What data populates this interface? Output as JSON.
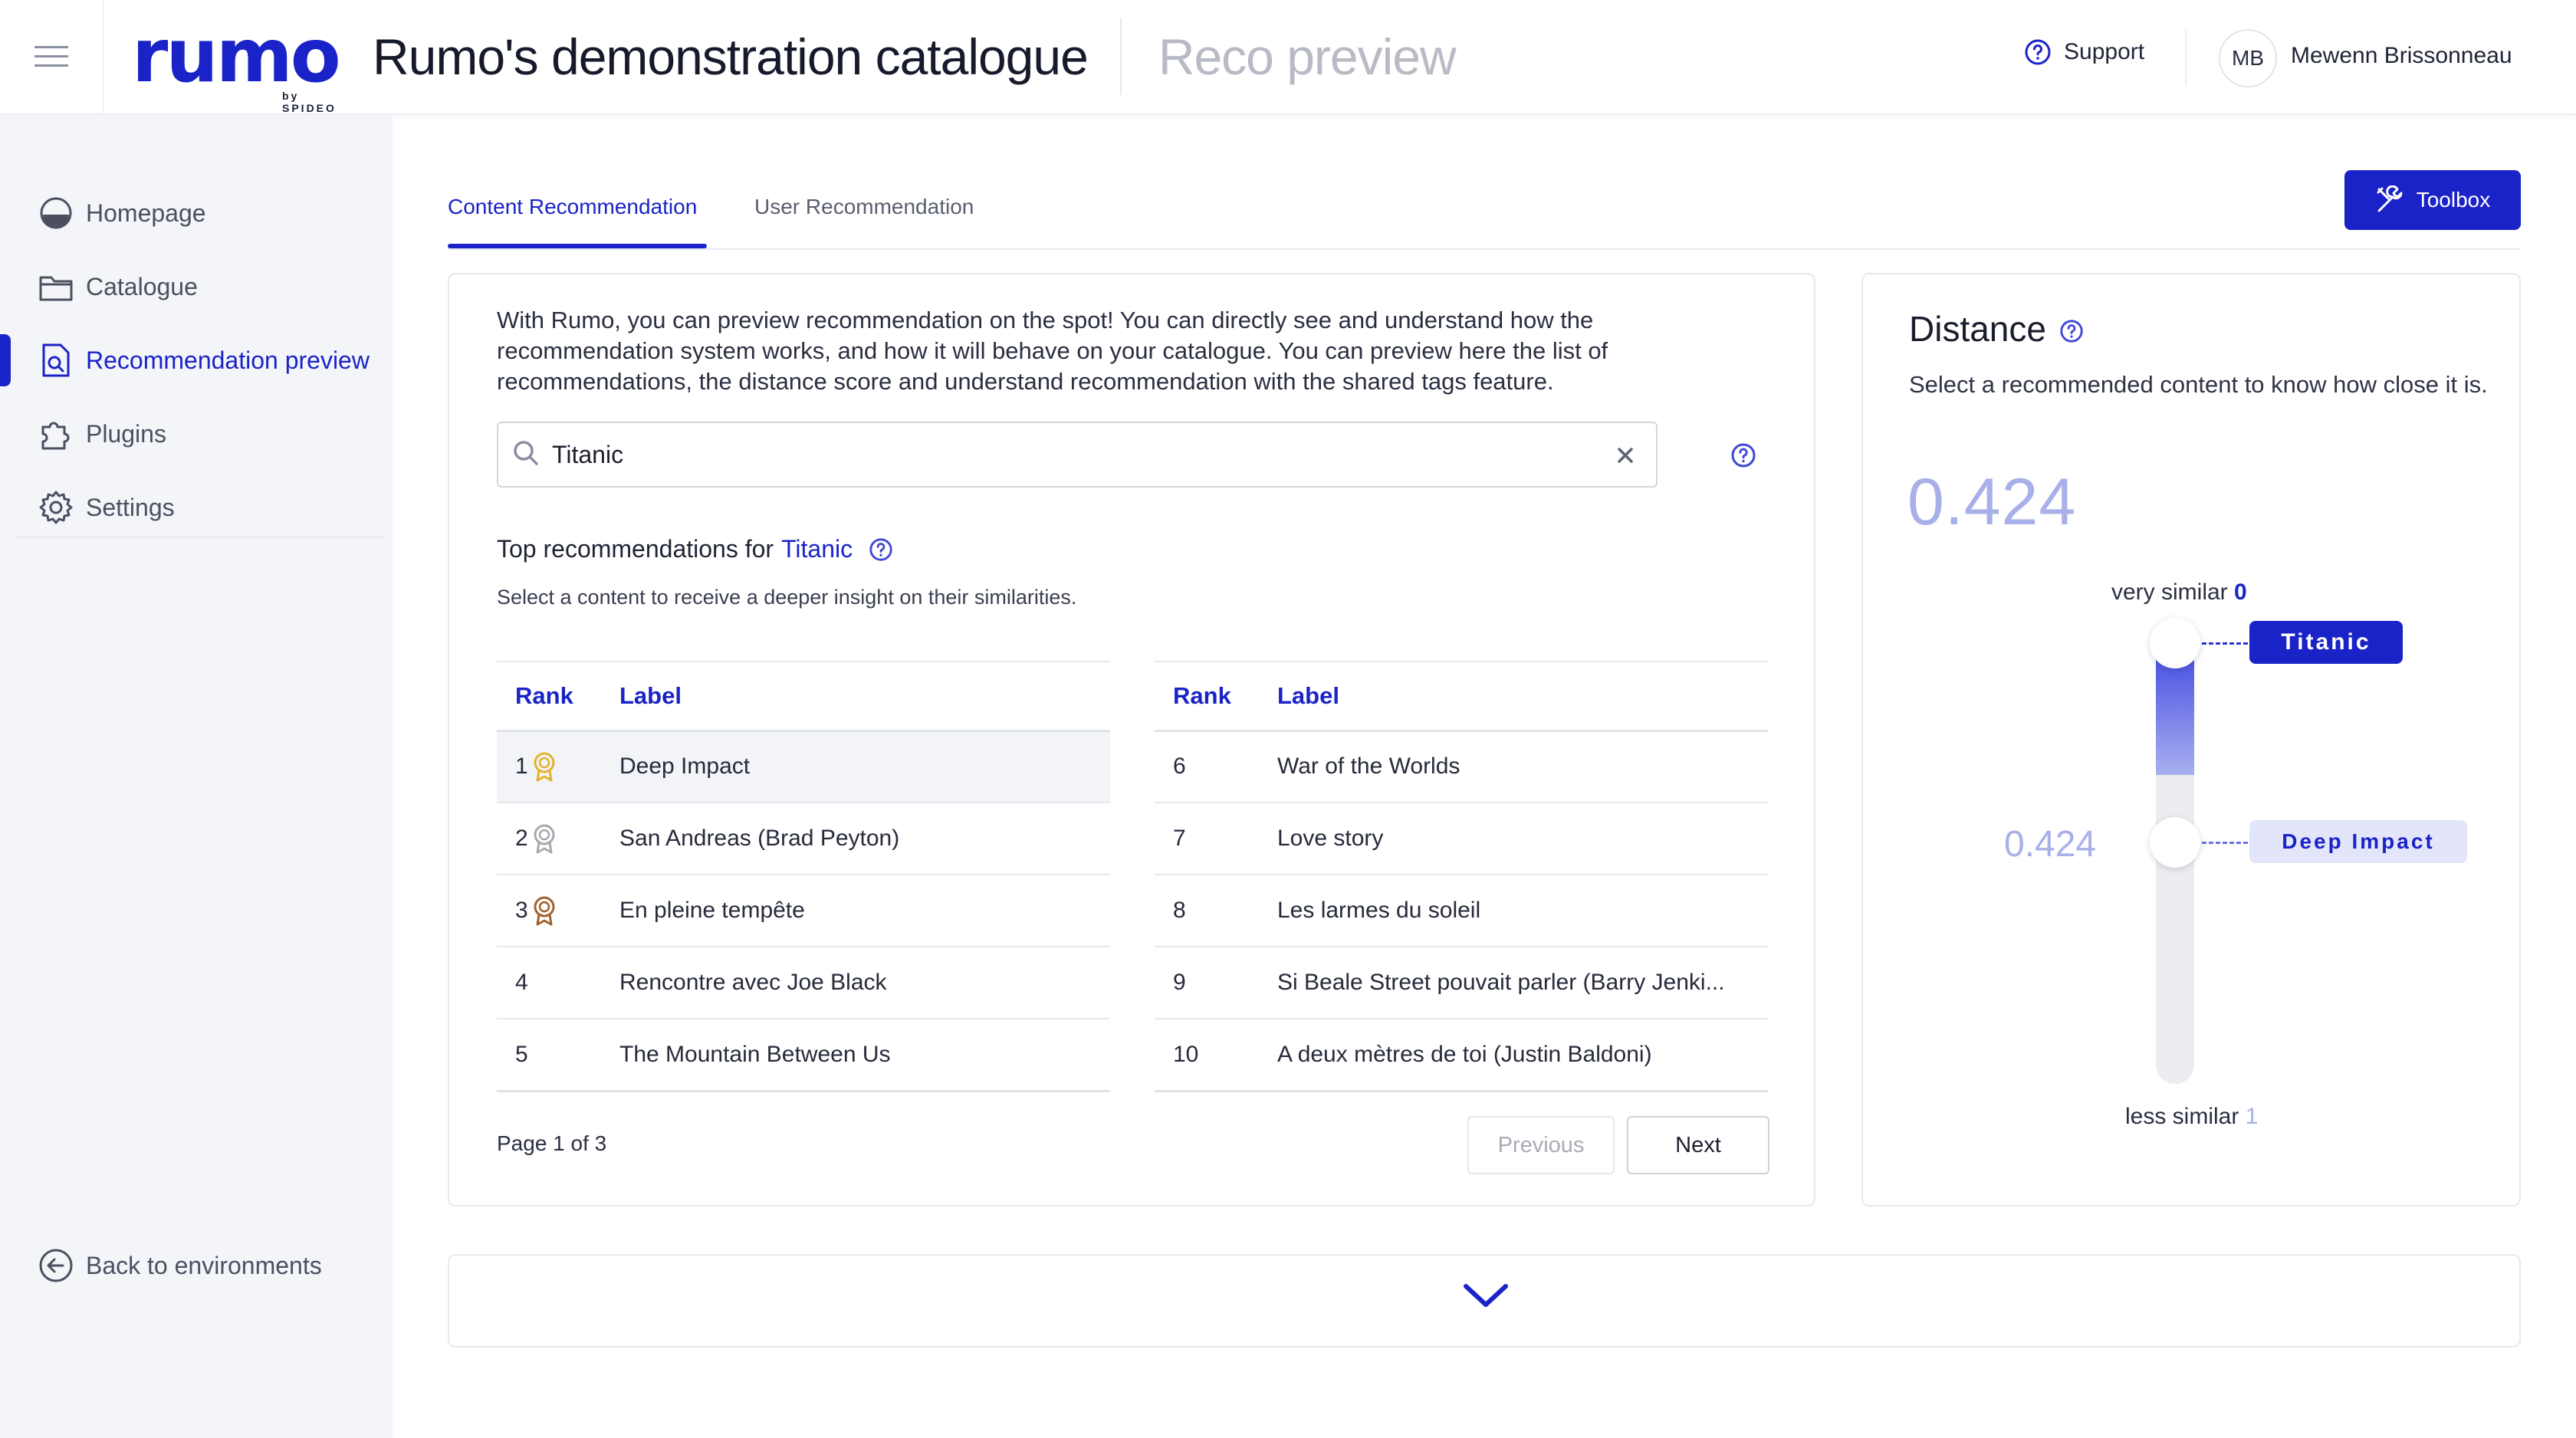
{
  "header": {
    "logo": "rumo",
    "logo_sub": "by SPIDEO",
    "title": "Rumo's demonstration catalogue",
    "subtitle": "Reco preview",
    "support": "Support",
    "user_initials": "MB",
    "user_name": "Mewenn Brissonneau"
  },
  "sidebar": {
    "items": [
      {
        "label": "Homepage",
        "icon": "homepage-icon"
      },
      {
        "label": "Catalogue",
        "icon": "folder-icon"
      },
      {
        "label": "Recommendation preview",
        "icon": "document-search-icon",
        "active": true
      },
      {
        "label": "Plugins",
        "icon": "puzzle-icon"
      },
      {
        "label": "Settings",
        "icon": "gear-icon"
      }
    ],
    "back": "Back to environments"
  },
  "tabs": {
    "content": "Content Recommendation",
    "user": "User Recommendation",
    "toolbox": "Toolbox"
  },
  "main": {
    "intro": "With Rumo, you can preview recommendation on the spot! You can directly see and understand how the recommendation system works, and how it will behave on your catalogue. You can preview here the list of recommendations, the distance score and understand recommendation with the shared tags feature.",
    "search_value": "Titanic",
    "reco_prefix": "Top recommendations for",
    "reco_film": "Titanic",
    "reco_sub": "Select a content to receive a deeper insight on their similarities.",
    "col_rank": "Rank",
    "col_label": "Label",
    "rows_left": [
      {
        "rank": "1",
        "label": "Deep Impact",
        "medal": "gold"
      },
      {
        "rank": "2",
        "label": "San Andreas (Brad Peyton)",
        "medal": "silver"
      },
      {
        "rank": "3",
        "label": "En pleine tempête",
        "medal": "bronze"
      },
      {
        "rank": "4",
        "label": "Rencontre avec Joe Black"
      },
      {
        "rank": "5",
        "label": "The Mountain Between Us"
      }
    ],
    "rows_right": [
      {
        "rank": "6",
        "label": "War of the Worlds"
      },
      {
        "rank": "7",
        "label": "Love story"
      },
      {
        "rank": "8",
        "label": "Les larmes du soleil"
      },
      {
        "rank": "9",
        "label": "Si Beale Street pouvait parler (Barry Jenki..."
      },
      {
        "rank": "10",
        "label": "A deux mètres de toi (Justin Baldoni)"
      }
    ],
    "page_info": "Page 1 of 3",
    "prev": "Previous",
    "next": "Next"
  },
  "distance": {
    "title": "Distance",
    "desc": "Select a recommended content to know how close it is.",
    "value": "0.424",
    "very_similar": "very similar",
    "very_similar_val": "0",
    "less_similar": "less similar",
    "less_similar_val": "1",
    "top_label": "Titanic",
    "bottom_label": "Deep Impact",
    "scale_value": "0.424",
    "fraction": 0.424
  },
  "colors": {
    "accent": "#1a23c7",
    "accent_light": "#a7b0e8"
  }
}
